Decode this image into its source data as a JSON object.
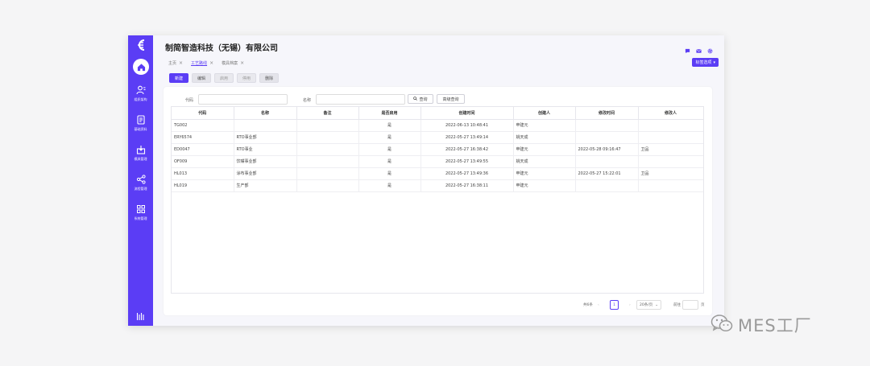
{
  "app": {
    "company_name": "制简智造科技（无锡）有限公司",
    "brand_color": "#5b3df5"
  },
  "sidebar": {
    "logo_icon": "logo-icon",
    "items": [
      {
        "label": "组织架构",
        "icon": "user-group-icon"
      },
      {
        "label": "基础资料",
        "icon": "document-icon"
      },
      {
        "label": "模具管理",
        "icon": "inbox-icon"
      },
      {
        "label": "流程管理",
        "icon": "share-icon"
      },
      {
        "label": "系统管理",
        "icon": "grid-icon"
      }
    ]
  },
  "header": {
    "icons": [
      "chat-icon",
      "mail-icon",
      "gear-icon"
    ]
  },
  "tabs": [
    {
      "label": "主页",
      "active": false
    },
    {
      "label": "工艺路线",
      "active": true
    },
    {
      "label": "模具档案",
      "active": false
    }
  ],
  "nav_options_label": "标签选项",
  "toolbar": {
    "new": "新建",
    "edit": "编辑",
    "enable": "启用",
    "disable": "停用",
    "delete": "删除"
  },
  "search": {
    "code_label": "代码",
    "code_value": "",
    "name_label": "名称",
    "name_value": "",
    "query_button": "查询",
    "advanced_button": "高级查询"
  },
  "table": {
    "columns": [
      "代码",
      "名称",
      "备注",
      "是否启用",
      "创建时间",
      "创建人",
      "修改时间",
      "修改人"
    ],
    "rows": [
      [
        "TG002",
        "",
        "",
        "是",
        "2022-06-13 10:48:41",
        "申建元",
        "",
        ""
      ],
      [
        "ERY6574",
        "RTO事业部",
        "",
        "是",
        "2022-05-27 13:49:14",
        "姚天成",
        "",
        ""
      ],
      [
        "ED0047",
        "RTO事业",
        "",
        "是",
        "2022-05-27 16:38:42",
        "申建元",
        "2022-05-28 09:16:47",
        "卫品"
      ],
      [
        "OF009",
        "饮嘴事业部",
        "",
        "是",
        "2022-05-27 13:49:55",
        "姚天成",
        "",
        ""
      ],
      [
        "HL013",
        "涂布事业部",
        "",
        "是",
        "2022-05-27 13:49:36",
        "申建元",
        "2022-05-27 15:22:01",
        "卫品"
      ],
      [
        "HL019",
        "生产部",
        "",
        "是",
        "2022-05-27 16:38:11",
        "申建元",
        "",
        ""
      ]
    ]
  },
  "pager": {
    "total": "共6条",
    "prev": "‹",
    "current_page": "1",
    "next": "›",
    "page_size": "20条/页",
    "goto_label": "前往",
    "goto_value": "",
    "page_unit": "页"
  },
  "watermark": {
    "text": "MES工厂",
    "icon": "wechat-icon"
  }
}
